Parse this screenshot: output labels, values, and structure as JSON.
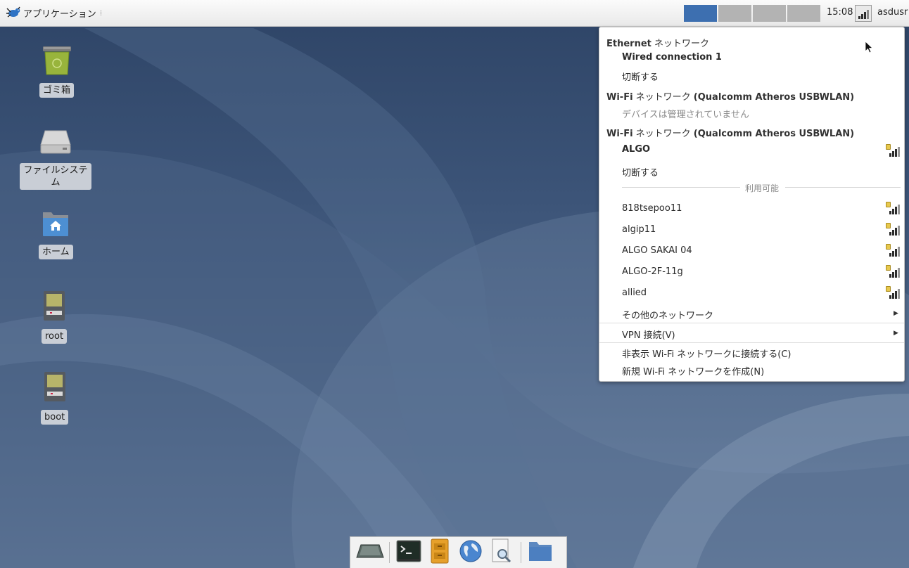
{
  "panel": {
    "app_menu_label": "アプリケーション",
    "clock": "15:08",
    "username": "asdusr",
    "workspaces": 4,
    "active_workspace": 1
  },
  "desktop_icons": {
    "trash": "ゴミ箱",
    "filesystem": "ファイルシステム",
    "home": "ホーム",
    "root": "root",
    "boot": "boot"
  },
  "network_menu": {
    "ethernet_header_bold": "Ethernet",
    "ethernet_header_rest": " ネットワーク",
    "wired_connection": "Wired connection 1",
    "ethernet_disconnect": "切断する",
    "wifi1_header_bold": "Wi-Fi",
    "wifi1_header_rest": " ネットワーク ",
    "wifi1_device": "(Qualcomm Atheros USBWLAN)",
    "wifi1_status": "デバイスは管理されていません",
    "wifi2_header_bold": "Wi-Fi",
    "wifi2_header_rest": " ネットワーク ",
    "wifi2_device": "(Qualcomm Atheros USBWLAN)",
    "connected_network": "ALGO",
    "wifi2_disconnect": "切断する",
    "available_label": "利用可能",
    "networks": [
      "818tsepoo11",
      "algip11",
      "ALGO SAKAI 04",
      "ALGO-2F-11g",
      "allied"
    ],
    "other_networks": "その他のネットワーク",
    "vpn": "VPN 接続(V)",
    "connect_hidden": "非表示 Wi-Fi ネットワークに接続する(C)",
    "create_new": "新規 Wi-Fi ネットワークを作成(N)"
  },
  "colors": {
    "active_workspace": "#3d6fb0",
    "inactive_workspace": "#b3b3b3",
    "lock": "#e8c94e"
  },
  "icons": {
    "app_menu": "xfce-mouse-icon",
    "trash": "trash-icon",
    "filesystem": "drive-icon",
    "home": "home-folder-icon",
    "root": "drive-icon",
    "boot": "drive-icon",
    "dock": [
      "show-desktop-icon",
      "terminal-icon",
      "file-manager-icon",
      "web-browser-icon",
      "search-icon",
      "folder-icon"
    ]
  }
}
